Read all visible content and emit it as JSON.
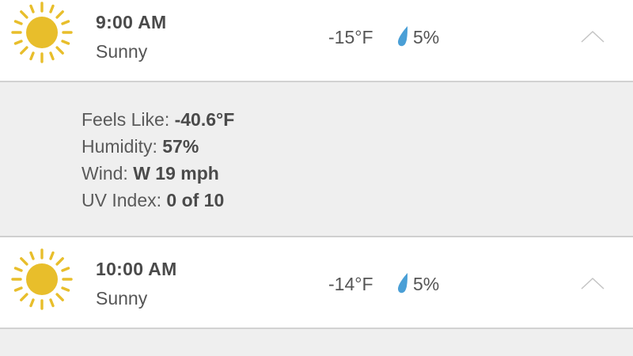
{
  "hours": [
    {
      "time": "9:00 AM",
      "condition": "Sunny",
      "temperature": "-15°F",
      "precipitation": "5%",
      "icon": "sun-icon",
      "expanded": true
    },
    {
      "time": "10:00 AM",
      "condition": "Sunny",
      "temperature": "-14°F",
      "precipitation": "5%",
      "icon": "sun-icon",
      "expanded": false
    }
  ],
  "details": {
    "feels_like_label": "Feels Like: ",
    "feels_like_value": "-40.6°F",
    "humidity_label": "Humidity: ",
    "humidity_value": "57%",
    "wind_label": "Wind: ",
    "wind_value": "W 19 mph",
    "uv_label": "UV Index: ",
    "uv_value": "0 of 10"
  },
  "colors": {
    "sun": "#e8be2b",
    "drop": "#4a9fd6",
    "divider": "#d2d2d2",
    "panel": "#efefef"
  }
}
